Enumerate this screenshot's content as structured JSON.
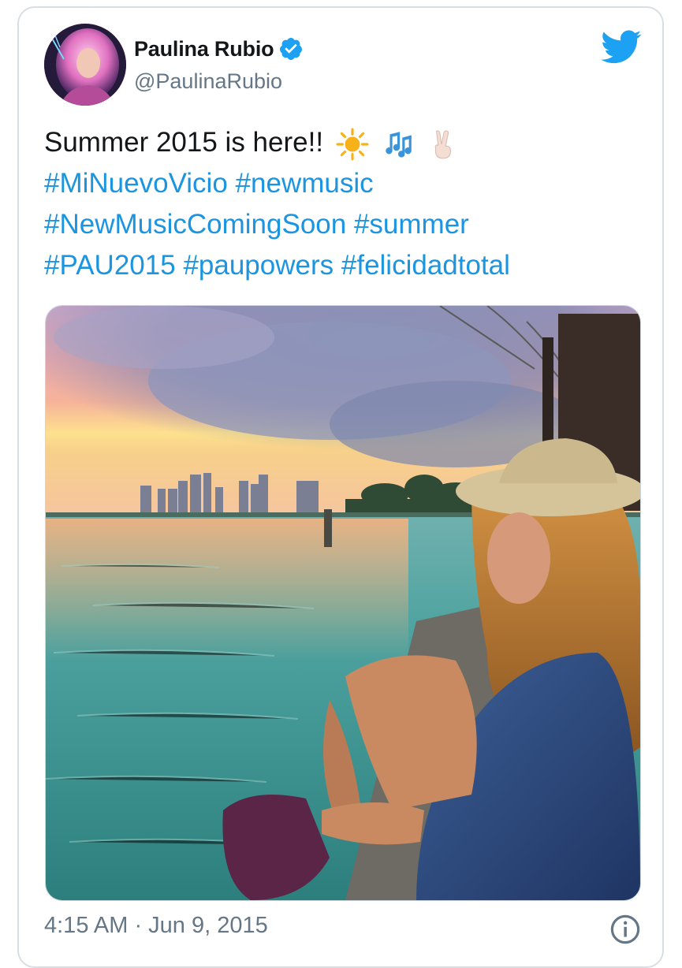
{
  "tweet": {
    "author": {
      "display_name": "Paulina Rubio",
      "handle": "@PaulinaRubio",
      "verified": true
    },
    "text_line1": "Summer 2015 is here!!",
    "emojis": [
      "sun-emoji",
      "music-notes-emoji",
      "victory-hand-emoji"
    ],
    "hashtags_line2": [
      "#MiNuevoVicio",
      "#newmusic"
    ],
    "hashtags_line3": [
      "#NewMusicComingSoon",
      "#summer"
    ],
    "hashtags_line4": [
      "#PAU2015",
      "#paupowers",
      "#felicidadtotal"
    ],
    "timestamp": "4:15 AM · Jun 9, 2015"
  },
  "colors": {
    "link": "#1b95e0",
    "text": "#14171a",
    "muted": "#657786",
    "twitter_blue": "#1da1f2"
  },
  "icons": {
    "brand": "twitter-bird-icon",
    "verified": "verified-badge-icon",
    "info": "info-icon"
  }
}
